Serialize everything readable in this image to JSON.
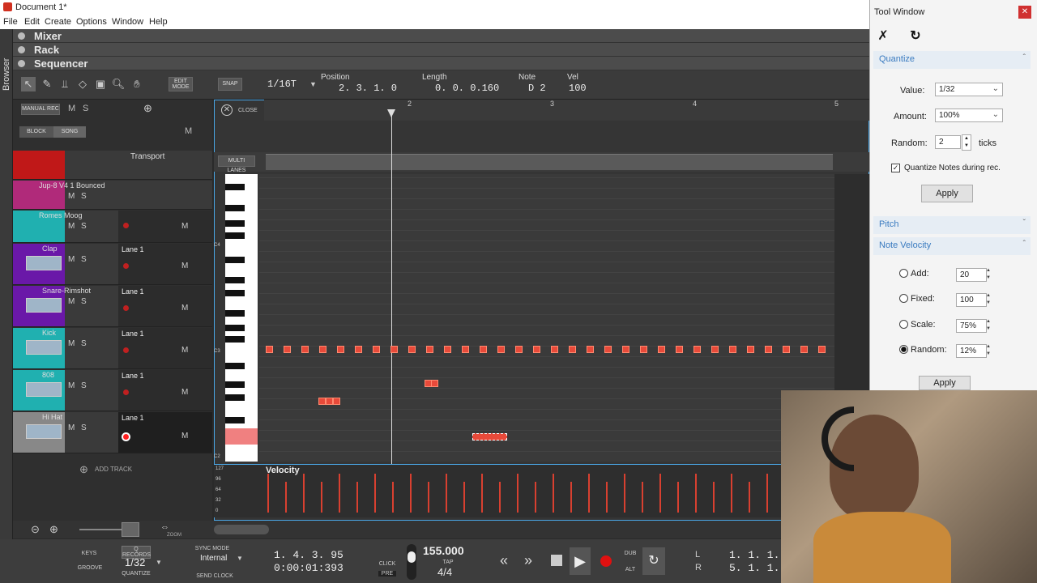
{
  "app": {
    "title": "Document 1*"
  },
  "menu": [
    "File",
    "Edit",
    "Create",
    "Options",
    "Window",
    "Help"
  ],
  "browser_label": "Browser",
  "panels": [
    "Mixer",
    "Rack",
    "Sequencer"
  ],
  "toolbar": {
    "edit_mode": "EDIT MODE",
    "snap": "SNAP",
    "grid": "1/16T",
    "position_label": "Position",
    "position": "2. 3. 1. 0",
    "length_label": "Length",
    "length": "0. 0. 0.160",
    "note_label": "Note",
    "note": "D 2",
    "vel_label": "Vel",
    "vel": "100"
  },
  "trackhdr": {
    "manual_rec": "MANUAL REC",
    "block": "BLOCK",
    "song": "SONG",
    "m": "M",
    "s": "S"
  },
  "tracks": [
    {
      "name": "Transport",
      "lane": ""
    },
    {
      "name": "Jup-8 V4 1 Bounced",
      "lane": ""
    },
    {
      "name": "Romes Moog",
      "lane": ""
    },
    {
      "name": "Clap",
      "lane": "Lane 1"
    },
    {
      "name": "Snare-Rimshot",
      "lane": "Lane 1"
    },
    {
      "name": "Kick",
      "lane": "Lane 1"
    },
    {
      "name": "808",
      "lane": "Lane 1"
    },
    {
      "name": "Hi Hat",
      "lane": "Lane 1"
    }
  ],
  "add_track": "ADD TRACK",
  "editor": {
    "close": "CLOSE",
    "multi_lanes": "MULTI LANES",
    "ruler": [
      "2",
      "3",
      "4",
      "5"
    ],
    "keys": [
      "C4",
      "C3",
      "C2"
    ],
    "velocity": "Velocity",
    "vel_ticks": [
      "127",
      "96",
      "64",
      "32",
      "0"
    ]
  },
  "transport": {
    "keys": "KEYS",
    "groove": "GROOVE",
    "q_records": "Q RECORDS",
    "quantize_val": "1/32",
    "quantize": "QUANTIZE",
    "sync_mode": "SYNC MODE",
    "sync": "Internal",
    "send_clock": "SEND CLOCK",
    "pos1": "1. 4. 3. 95",
    "pos2": "0:00:01:393",
    "click": "CLICK",
    "pre": "PRE",
    "tempo": "155.000",
    "tap": "TAP",
    "sig": "4/4",
    "dub": "DUB",
    "alt": "ALT",
    "l": "L",
    "r": "R",
    "lpos": "1. 1. 1.",
    "rpos": "5. 1. 1.",
    "zoom": "ZOOM"
  },
  "toolwindow": {
    "title": "Tool Window",
    "quantize": {
      "header": "Quantize",
      "value_label": "Value:",
      "value": "1/32",
      "amount_label": "Amount:",
      "amount": "100%",
      "random_label": "Random:",
      "random": "2",
      "ticks": "ticks",
      "checkbox": "Quantize Notes during rec.",
      "apply": "Apply"
    },
    "pitch": "Pitch",
    "note_velocity": {
      "header": "Note Velocity",
      "add_label": "Add:",
      "add": "20",
      "fixed_label": "Fixed:",
      "fixed": "100",
      "scale_label": "Scale:",
      "scale": "75%",
      "random_label": "Random:",
      "random": "12%",
      "apply": "Apply"
    }
  }
}
